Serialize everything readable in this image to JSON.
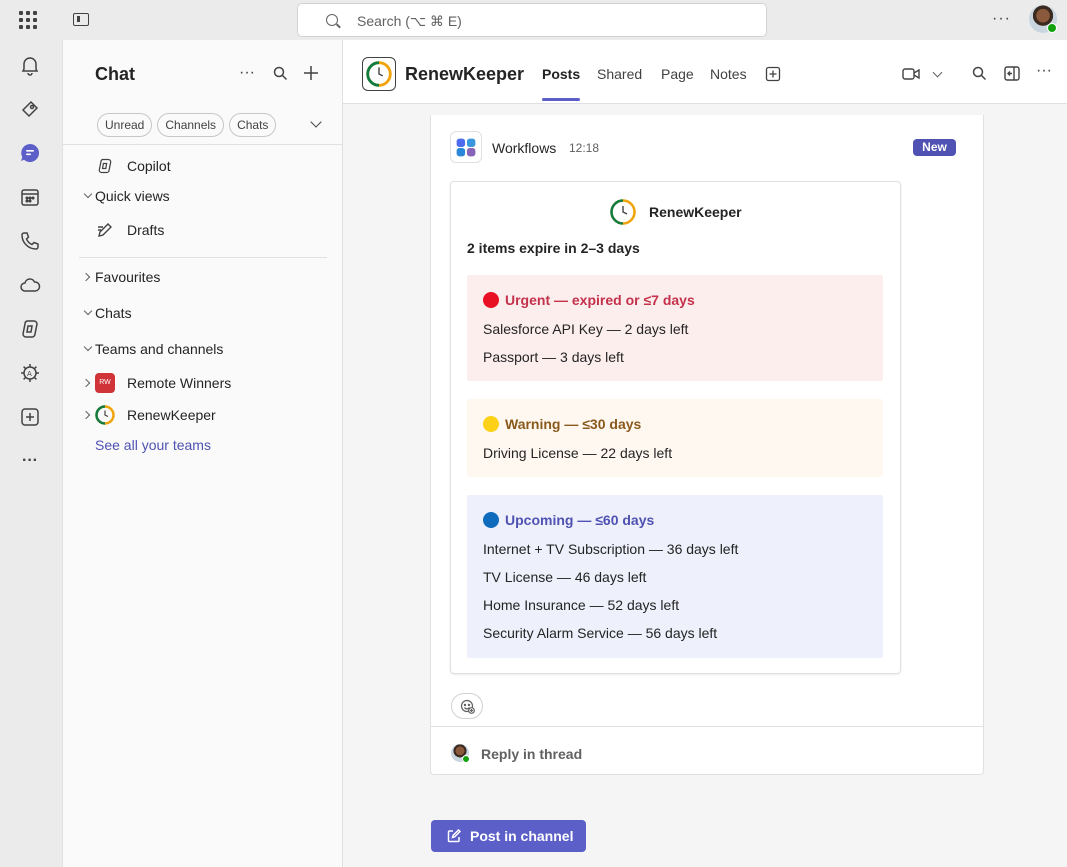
{
  "search": {
    "placeholder": "Search (⌥ ⌘ E)"
  },
  "chat_pane": {
    "title": "Chat",
    "filters": [
      "Unread",
      "Channels",
      "Chats"
    ],
    "copilot_label": "Copilot",
    "quick_views_label": "Quick views",
    "drafts_label": "Drafts",
    "favourites_label": "Favourites",
    "chats_label": "Chats",
    "teams_label": "Teams and channels",
    "teams": [
      {
        "name": "Remote Winners",
        "initials": "RW",
        "color": "#d13438"
      },
      {
        "name": "RenewKeeper"
      }
    ],
    "see_all": "See all your teams"
  },
  "channel": {
    "name": "RenewKeeper",
    "tabs": [
      "Posts",
      "Shared",
      "Page",
      "Notes"
    ],
    "active_tab": "Posts"
  },
  "post": {
    "author": "Workflows",
    "time": "12:18",
    "badge": "New",
    "card": {
      "title": "RenewKeeper",
      "summary": "2 items expire in 2–3 days",
      "sections": [
        {
          "heading": "Urgent — expired or ≤7 days",
          "dot_color": "#e81123",
          "heading_color": "#c4314b",
          "bg": "#fdeeee",
          "items": [
            "Salesforce API Key — 2 days left",
            "Passport — 3 days left"
          ]
        },
        {
          "heading": "Warning — ≤30 days",
          "dot_color": "#fcd116",
          "heading_color": "#8a5a1c",
          "bg": "#fff8f0",
          "items": [
            "Driving License — 22 days left"
          ]
        },
        {
          "heading": "Upcoming — ≤60 days",
          "dot_color": "#0f6cbd",
          "heading_color": "#4f52b2",
          "bg": "#eef0fb",
          "items": [
            "Internet + TV Subscription — 36 days left",
            "TV License — 46 days left",
            "Home Insurance — 52 days left",
            "Security Alarm Service — 56 days left"
          ]
        }
      ]
    },
    "reply_label": "Reply in thread"
  },
  "post_button_label": "Post in channel"
}
